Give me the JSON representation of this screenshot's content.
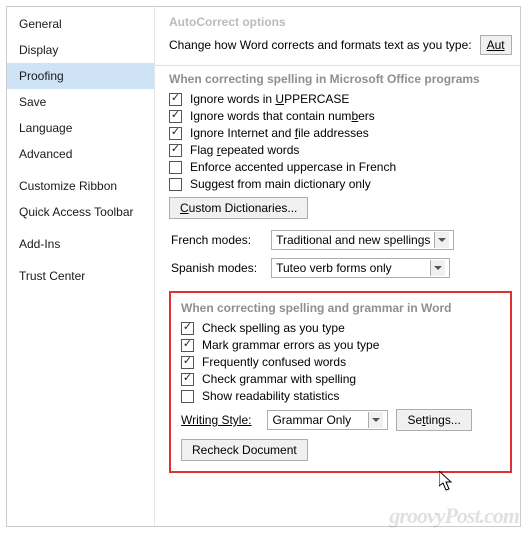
{
  "sidebar": {
    "items": [
      {
        "label": "General"
      },
      {
        "label": "Display"
      },
      {
        "label": "Proofing",
        "selected": true
      },
      {
        "label": "Save"
      },
      {
        "label": "Language"
      },
      {
        "label": "Advanced"
      },
      {
        "label": "Customize Ribbon"
      },
      {
        "label": "Quick Access Toolbar"
      },
      {
        "label": "Add-Ins"
      },
      {
        "label": "Trust Center"
      }
    ]
  },
  "content": {
    "section_autocorrect": "AutoCorrect options",
    "intro_text": "Change how Word corrects and formats text as you type:",
    "intro_button_visible": "Aut",
    "section_office": "When correcting spelling in Microsoft Office programs",
    "office_checks": [
      {
        "before": "Ignore words in ",
        "u": "U",
        "after": "PPERCASE",
        "checked": true
      },
      {
        "before": "Ignore words that contain num",
        "u": "b",
        "after": "ers",
        "checked": true
      },
      {
        "before": "Ignore Internet and ",
        "u": "f",
        "after": "ile addresses",
        "checked": true
      },
      {
        "before": "Flag ",
        "u": "r",
        "after": "epeated words",
        "checked": true
      },
      {
        "before": "Enforce accented uppercase in French",
        "u": "",
        "after": "",
        "checked": false
      },
      {
        "before": "Suggest from main dictionary only",
        "u": "",
        "after": "",
        "checked": false
      }
    ],
    "custom_dict_btn": "Custom Dictionaries...",
    "french_label": "French modes:",
    "french_value": "Traditional and new spellings",
    "spanish_label": "Spanish modes:",
    "spanish_value": "Tuteo verb forms only",
    "section_word": "When correcting spelling and grammar in Word",
    "word_checks": [
      {
        "label": "Check spelling as you type",
        "checked": true
      },
      {
        "label": "Mark grammar errors as you type",
        "checked": true
      },
      {
        "label": "Frequently confused words",
        "checked": true
      },
      {
        "label": "Check grammar with spelling",
        "checked": true
      },
      {
        "label": "Show readability statistics",
        "checked": false
      }
    ],
    "writing_style_label": "Writing Style:",
    "writing_style_value": "Grammar Only",
    "settings_btn": "Settings...",
    "recheck_btn": "Recheck Document"
  },
  "watermark": "groovyPost.com"
}
